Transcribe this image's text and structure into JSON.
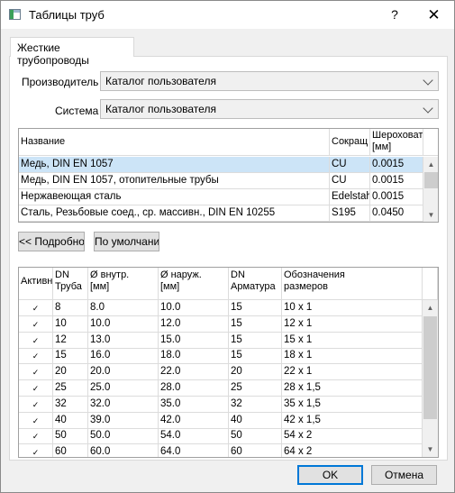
{
  "window": {
    "title": "Таблицы труб",
    "help_glyph": "?",
    "close_glyph": "✕"
  },
  "tab": {
    "label": "Жесткие трубопроводы"
  },
  "form": {
    "manufacturer_label": "Производитель",
    "manufacturer_value": "Каталог пользователя",
    "system_label": "Система",
    "system_value": "Каталог пользователя"
  },
  "materials": {
    "columns": [
      "Название",
      "Сокращ",
      "Шероховат\n[мм]"
    ],
    "rows": [
      [
        "Медь, DIN EN 1057",
        "CU",
        "0.0015"
      ],
      [
        "Медь, DIN EN 1057, отопительные трубы",
        "CU",
        "0.0015"
      ],
      [
        "Нержавеющая сталь",
        "Edelstahl",
        "0.0015"
      ],
      [
        "Сталь, Резьбовые соед., ср. массивн., DIN EN 10255",
        "S195",
        "0.0450"
      ]
    ]
  },
  "buttons": {
    "details": "<< Подробно",
    "default": "По умолчанию",
    "ok": "OK",
    "cancel": "Отмена"
  },
  "sizes": {
    "columns": [
      "Активн",
      "DN\nТруба",
      "Ø внутр.\n[мм]",
      "Ø наруж.\n[мм]",
      "DN\nАрматура",
      "Обозначения\nразмеров"
    ],
    "check_glyph": "✓",
    "rows": [
      [
        "8",
        "8.0",
        "10.0",
        "15",
        "10 x 1"
      ],
      [
        "10",
        "10.0",
        "12.0",
        "15",
        "12 x 1"
      ],
      [
        "12",
        "13.0",
        "15.0",
        "15",
        "15 x 1"
      ],
      [
        "15",
        "16.0",
        "18.0",
        "15",
        "18 x 1"
      ],
      [
        "20",
        "20.0",
        "22.0",
        "20",
        "22 x 1"
      ],
      [
        "25",
        "25.0",
        "28.0",
        "25",
        "28 x 1,5"
      ],
      [
        "32",
        "32.0",
        "35.0",
        "32",
        "35 x 1,5"
      ],
      [
        "40",
        "39.0",
        "42.0",
        "40",
        "42 x 1,5"
      ],
      [
        "50",
        "50.0",
        "54.0",
        "50",
        "54 x 2"
      ],
      [
        "60",
        "60.0",
        "64.0",
        "60",
        "64 x 2"
      ]
    ]
  }
}
